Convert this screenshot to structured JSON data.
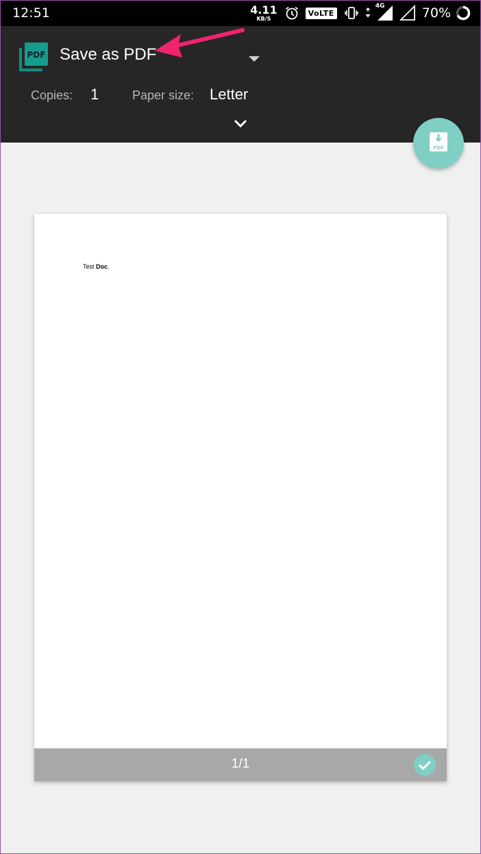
{
  "status_bar": {
    "time": "12:51",
    "net_speed_value": "4.11",
    "net_speed_unit": "KB/S",
    "volte": "VoLTE",
    "network_type": "4G",
    "battery_percent": "70%",
    "icons": [
      "alarm-icon",
      "vibrate-icon",
      "data-transfer-icon",
      "signal-icon",
      "battery-icon"
    ]
  },
  "toolbar": {
    "printer_name": "Save as PDF",
    "printer_icon_text": "PDF",
    "copies_label": "Copies:",
    "copies_value": "1",
    "paper_size_label": "Paper size:",
    "paper_size_value": "Letter"
  },
  "fab": {
    "icon_text": "PDF",
    "icon": "download-pdf-icon"
  },
  "preview": {
    "doc_text_normal": "Test ",
    "doc_text_bold": "Doc",
    "doc_text_end": ".",
    "page_indicator": "1/1"
  },
  "colors": {
    "toolbar_bg": "#262626",
    "accent_teal": "#7fcfc4",
    "annotation_arrow": "#f0246e",
    "footer_gray": "#a8a8a8"
  }
}
